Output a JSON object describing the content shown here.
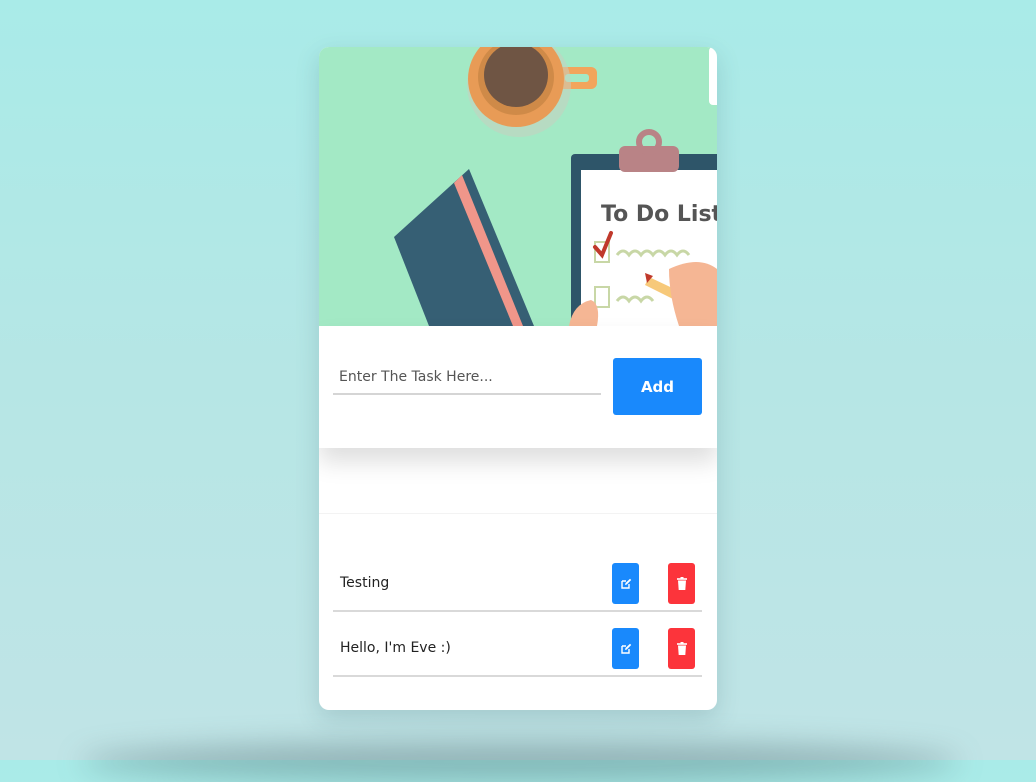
{
  "hero": {
    "heading": "To Do List"
  },
  "task_input": {
    "placeholder": "Enter The Task Here...",
    "value": ""
  },
  "add_button": {
    "label": "Add"
  },
  "tasks": [
    {
      "text": "Testing",
      "edit_icon": "edit-icon",
      "delete_icon": "trash-icon"
    },
    {
      "text": "Hello, I'm Eve :)",
      "edit_icon": "edit-icon",
      "delete_icon": "trash-icon"
    }
  ],
  "colors": {
    "accent_blue": "#1989fc",
    "delete_red": "#fc343b",
    "hero_green": "#a3e9c5",
    "background_teal": "#a9ebe8"
  }
}
